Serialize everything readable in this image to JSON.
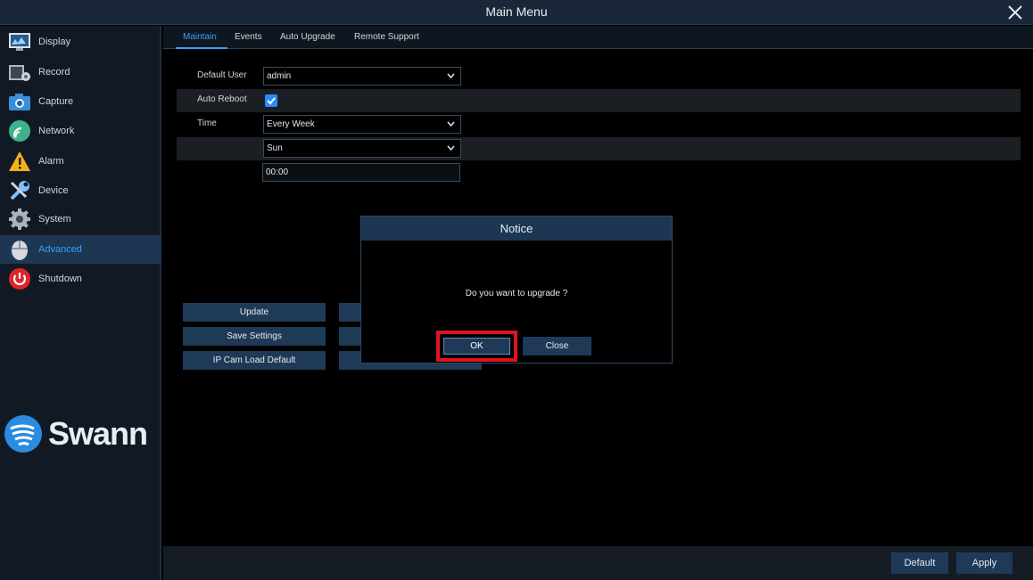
{
  "window": {
    "title": "Main Menu"
  },
  "sidebar": {
    "items": [
      {
        "label": "Display",
        "icon": "display-icon"
      },
      {
        "label": "Record",
        "icon": "record-icon"
      },
      {
        "label": "Capture",
        "icon": "capture-icon"
      },
      {
        "label": "Network",
        "icon": "network-icon"
      },
      {
        "label": "Alarm",
        "icon": "alarm-icon"
      },
      {
        "label": "Device",
        "icon": "device-icon"
      },
      {
        "label": "System",
        "icon": "system-icon"
      },
      {
        "label": "Advanced",
        "icon": "advanced-icon",
        "active": true
      },
      {
        "label": "Shutdown",
        "icon": "power-icon"
      }
    ],
    "logo_text": "Swann"
  },
  "tabs": [
    "Maintain",
    "Events",
    "Auto Upgrade",
    "Remote Support"
  ],
  "form": {
    "default_user_label": "Default User",
    "default_user_value": "admin",
    "auto_reboot_label": "Auto Reboot",
    "auto_reboot_checked": true,
    "time_label": "Time",
    "time_frequency": "Every Week",
    "time_day": "Sun",
    "time_clock": "00:00"
  },
  "actions": {
    "update": "Update",
    "save_settings": "Save Settings",
    "ip_cam_load_default": "IP Cam Load Default"
  },
  "footer": {
    "default_label": "Default",
    "apply_label": "Apply"
  },
  "dialog": {
    "title": "Notice",
    "message": "Do you want to upgrade ?",
    "ok_label": "OK",
    "close_label": "Close"
  },
  "colors": {
    "accent": "#3aa0ff",
    "button": "#1e3a57",
    "highlight": "#e0141e"
  }
}
